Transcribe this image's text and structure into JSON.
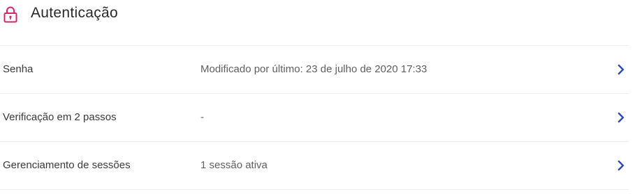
{
  "section": {
    "title": "Autenticação",
    "icon": "lock-icon",
    "accent_color": "#d6246e"
  },
  "rows": [
    {
      "label": "Senha",
      "value": "Modificado por último: 23 de julho de 2020 17:33",
      "chevron": "chevron-right-icon"
    },
    {
      "label": "Verificação em 2 passos",
      "value": "-",
      "chevron": "chevron-right-icon"
    },
    {
      "label": "Gerenciamento de sessões",
      "value": "1 sessão ativa",
      "chevron": "chevron-right-icon"
    }
  ],
  "colors": {
    "chevron": "#2f4bb8",
    "divider": "#ececec"
  }
}
